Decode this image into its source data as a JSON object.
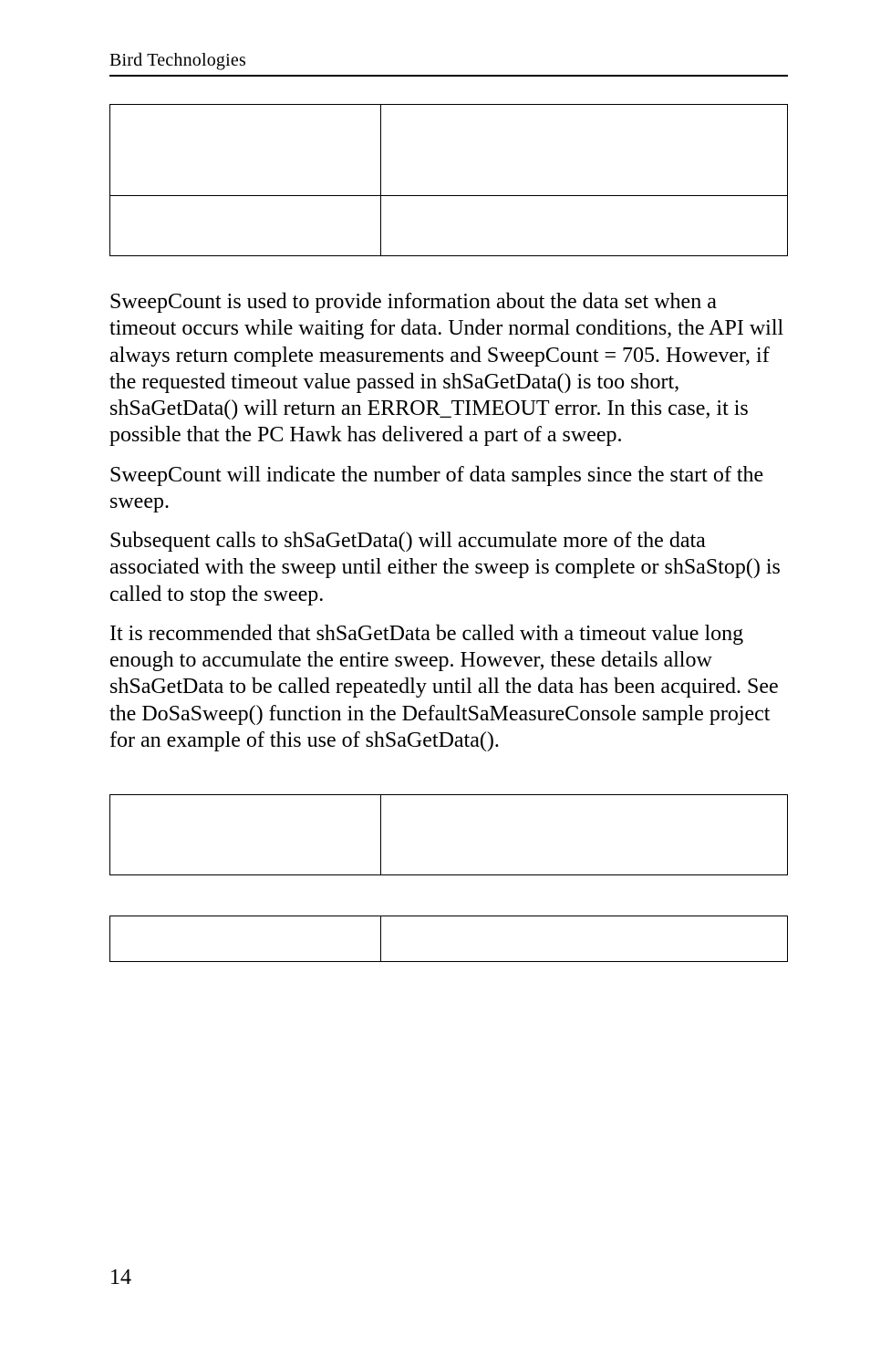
{
  "header": {
    "title": "Bird Technologies"
  },
  "table1": {
    "rows": [
      {
        "a": "",
        "b": ""
      },
      {
        "a": "",
        "b": ""
      }
    ]
  },
  "paragraphs": {
    "p1": "SweepCount is used to provide information about the data set when a timeout occurs while waiting for data. Under normal conditions, the API will always return complete measurements and SweepCount = 705. However, if the requested timeout value passed in shSaGetData() is too short, shSaGetData() will return an ERROR_TIMEOUT error. In this case, it is possible that the PC Hawk has delivered a part of a sweep.",
    "p2": "SweepCount will indicate the number of data samples since the start of the sweep.",
    "p3": "Subsequent calls to shSaGetData() will accumulate more of the data associated with the sweep until either the sweep is complete or shSaStop() is called to stop the sweep.",
    "p4": "It is recommended that shSaGetData be called with a timeout value long enough to accumulate the entire sweep. However, these details allow shSaGetData to be called repeatedly until all the data has been acquired. See the DoSaSweep() function in the DefaultSaMeasureConsole sample project for an example of this use of shSaGetData()."
  },
  "table2a": {
    "a": "",
    "b": ""
  },
  "table2b": {
    "a": "",
    "b": ""
  },
  "pageNumber": "14"
}
